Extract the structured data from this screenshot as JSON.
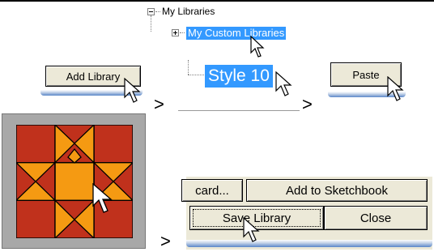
{
  "tree": {
    "root_label": "My Libraries",
    "child_label": "My Custom Libraries"
  },
  "step1": {
    "button_label": "Add Library"
  },
  "step2": {
    "new_node_label": "Style 10"
  },
  "step3": {
    "button_label": "Paste"
  },
  "step4": {
    "thumbnail_name": "quilt block thumbnail"
  },
  "step5": {
    "partial_label": "card...",
    "sketchbook_label": "Add to Sketchbook",
    "save_label": "Save Library",
    "close_label": "Close"
  },
  "separators": {
    "arrow": ">"
  },
  "colors": {
    "highlight": "#3399ff",
    "quilt_red": "#c0311c",
    "quilt_orange": "#f59a12"
  }
}
